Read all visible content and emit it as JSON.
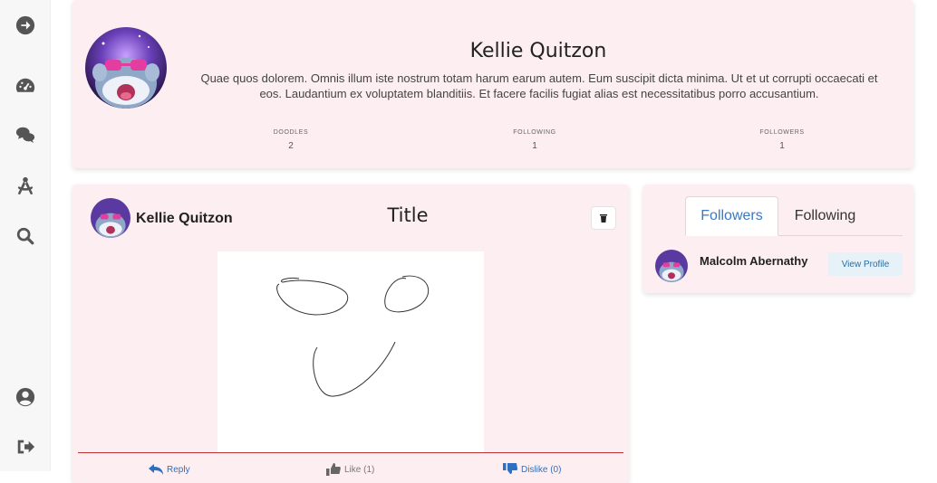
{
  "sidebar": {
    "items": [
      {
        "icon": "arrow-circle-right-icon"
      },
      {
        "icon": "dashboard-gauge-icon"
      },
      {
        "icon": "comments-icon"
      },
      {
        "icon": "drafting-compass-icon"
      },
      {
        "icon": "search-icon"
      },
      {
        "icon": "user-circle-icon"
      },
      {
        "icon": "sign-out-icon"
      }
    ]
  },
  "profile": {
    "name": "Kellie Quitzon",
    "bio": "Quae quos dolorem. Omnis illum iste nostrum totam harum earum autem. Eum suscipit dicta minima. Ut et ut corrupti occaecati et eos. Laudantium ex voluptatem blanditiis. Et facere facilis fugiat alias est necessitatibus porro accusantium.",
    "stats": [
      {
        "label": "DOODLES",
        "value": "2"
      },
      {
        "label": "FOLLOWING",
        "value": "1"
      },
      {
        "label": "FOLLOWERS",
        "value": "1"
      }
    ]
  },
  "doodle": {
    "author": "Kellie Quitzon",
    "title": "Title",
    "actions": {
      "reply": "Reply",
      "like": "Like (1)",
      "dislike": "Dislike (0)"
    }
  },
  "relations": {
    "tabs": [
      "Followers",
      "Following"
    ],
    "active_tab": "Followers",
    "followers": [
      {
        "name": "Malcolm Abernathy",
        "button": "View Profile"
      }
    ]
  },
  "colors": {
    "card_bg": "#fdeef1",
    "accent": "#3b78c4",
    "divider": "#b33333"
  }
}
